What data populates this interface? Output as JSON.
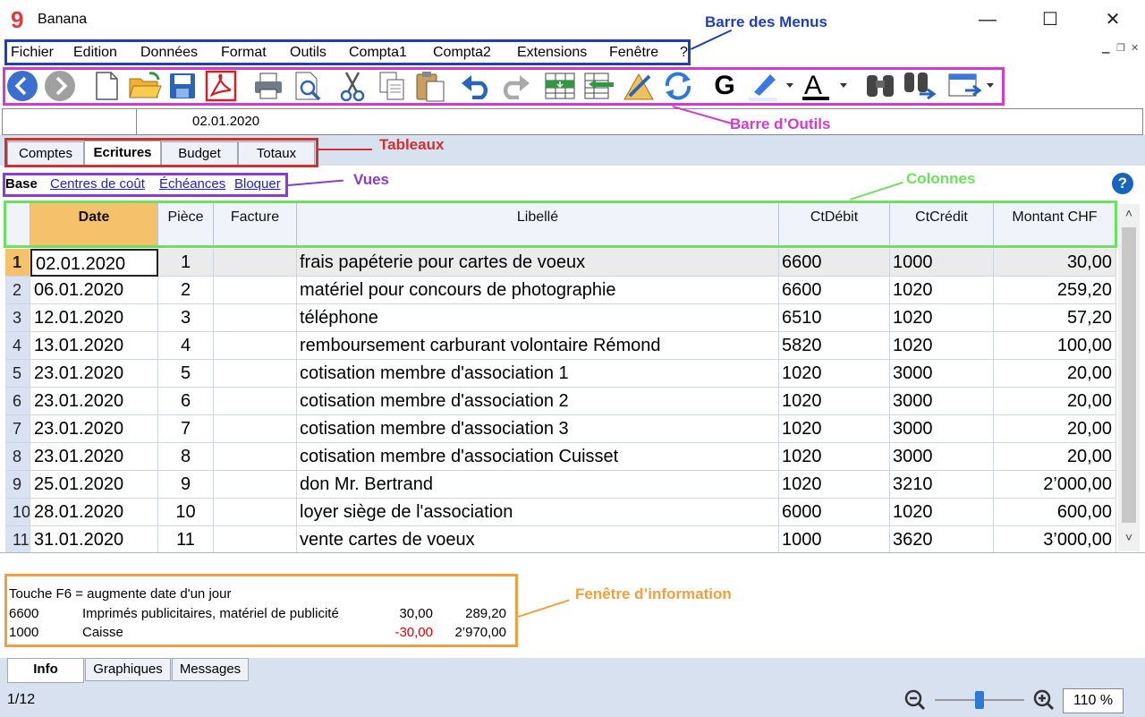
{
  "window": {
    "title": "Banana",
    "logo": "9"
  },
  "menus": [
    "Fichier",
    "Edition",
    "Données",
    "Format",
    "Outils",
    "Compta1",
    "Compta2",
    "Extensions",
    "Fenêtre",
    "?"
  ],
  "toolbar_icons": [
    "back-icon",
    "forward-icon",
    "new-file-icon",
    "open-folder-icon",
    "save-icon",
    "pdf-icon",
    "print-icon",
    "print-preview-icon",
    "cut-icon",
    "copy-icon",
    "paste-icon",
    "undo-icon",
    "redo-icon",
    "add-row-icon",
    "insert-rows-icon",
    "edit-icon",
    "recalculate-icon",
    "bold-icon",
    "highlight-icon",
    "text-color-icon",
    "find-icon",
    "find-next-icon",
    "window-icon"
  ],
  "cellbar": {
    "value": "02.01.2020"
  },
  "tabs": [
    "Comptes",
    "Ecritures",
    "Budget",
    "Totaux"
  ],
  "active_tab": "Ecritures",
  "views": [
    "Base",
    "Centres de coût",
    "Échéances",
    "Bloquer"
  ],
  "columns": [
    "Date",
    "Pièce",
    "Facture",
    "Libellé",
    "CtDébit",
    "CtCrédit",
    "Montant CHF"
  ],
  "rows": [
    {
      "n": "1",
      "date": "02.01.2020",
      "piece": "1",
      "facture": "",
      "libelle": "frais papéterie pour cartes de voeux",
      "debit": "6600",
      "credit": "1000",
      "montant": "30,00"
    },
    {
      "n": "2",
      "date": "06.01.2020",
      "piece": "2",
      "facture": "",
      "libelle": "matériel pour concours de photographie",
      "debit": "6600",
      "credit": "1020",
      "montant": "259,20"
    },
    {
      "n": "3",
      "date": "12.01.2020",
      "piece": "3",
      "facture": "",
      "libelle": "téléphone",
      "debit": "6510",
      "credit": "1020",
      "montant": "57,20"
    },
    {
      "n": "4",
      "date": "13.01.2020",
      "piece": "4",
      "facture": "",
      "libelle": "remboursement carburant volontaire Rémond",
      "debit": "5820",
      "credit": "1020",
      "montant": "100,00"
    },
    {
      "n": "5",
      "date": "23.01.2020",
      "piece": "5",
      "facture": "",
      "libelle": "cotisation membre d'association 1",
      "debit": "1020",
      "credit": "3000",
      "montant": "20,00"
    },
    {
      "n": "6",
      "date": "23.01.2020",
      "piece": "6",
      "facture": "",
      "libelle": "cotisation membre d'association 2",
      "debit": "1020",
      "credit": "3000",
      "montant": "20,00"
    },
    {
      "n": "7",
      "date": "23.01.2020",
      "piece": "7",
      "facture": "",
      "libelle": "cotisation membre d'association 3",
      "debit": "1020",
      "credit": "3000",
      "montant": "20,00"
    },
    {
      "n": "8",
      "date": "23.01.2020",
      "piece": "8",
      "facture": "",
      "libelle": "cotisation membre d'association Cuisset",
      "debit": "1020",
      "credit": "3000",
      "montant": "20,00"
    },
    {
      "n": "9",
      "date": "25.01.2020",
      "piece": "9",
      "facture": "",
      "libelle": "don Mr. Bertrand",
      "debit": "1020",
      "credit": "3210",
      "montant": "2’000,00"
    },
    {
      "n": "10",
      "date": "28.01.2020",
      "piece": "10",
      "facture": "",
      "libelle": "loyer siège de l'association",
      "debit": "6000",
      "credit": "1020",
      "montant": "600,00"
    },
    {
      "n": "11",
      "date": "31.01.2020",
      "piece": "11",
      "facture": "",
      "libelle": "vente cartes de voeux",
      "debit": "1000",
      "credit": "3620",
      "montant": "3’000,00"
    }
  ],
  "info": {
    "line1": "Touche F6 = augmente date d'un jour",
    "acc1": {
      "code": "6600",
      "name": "Imprimés publicitaires, matériel de publicité",
      "amount": "30,00",
      "balance": "289,20"
    },
    "acc2": {
      "code": "1000",
      "name": "Caisse",
      "amount": "-30,00",
      "balance": "2’970,00"
    }
  },
  "bottom_tabs": [
    "Info",
    "Graphiques",
    "Messages"
  ],
  "status": {
    "position": "1/12",
    "zoom": "110 %",
    "zoom_level_fraction": 0.5
  },
  "annotations": {
    "menus": "Barre des Menus",
    "toolbar": "Barre d’Outils",
    "tables": "Tableaux",
    "views": "Vues",
    "columns": "Colonnes",
    "info": "Fenêtre d’information"
  },
  "colors": {
    "menus": "#1f3fb5",
    "toolbar": "#d03bd0",
    "tables": "#d03030",
    "views": "#8a3bd0",
    "columns": "#6ee060",
    "info": "#f0a040",
    "date_header": "#f5c26b",
    "row_numbers": "#d8e2f2",
    "negative": "#e00000"
  }
}
